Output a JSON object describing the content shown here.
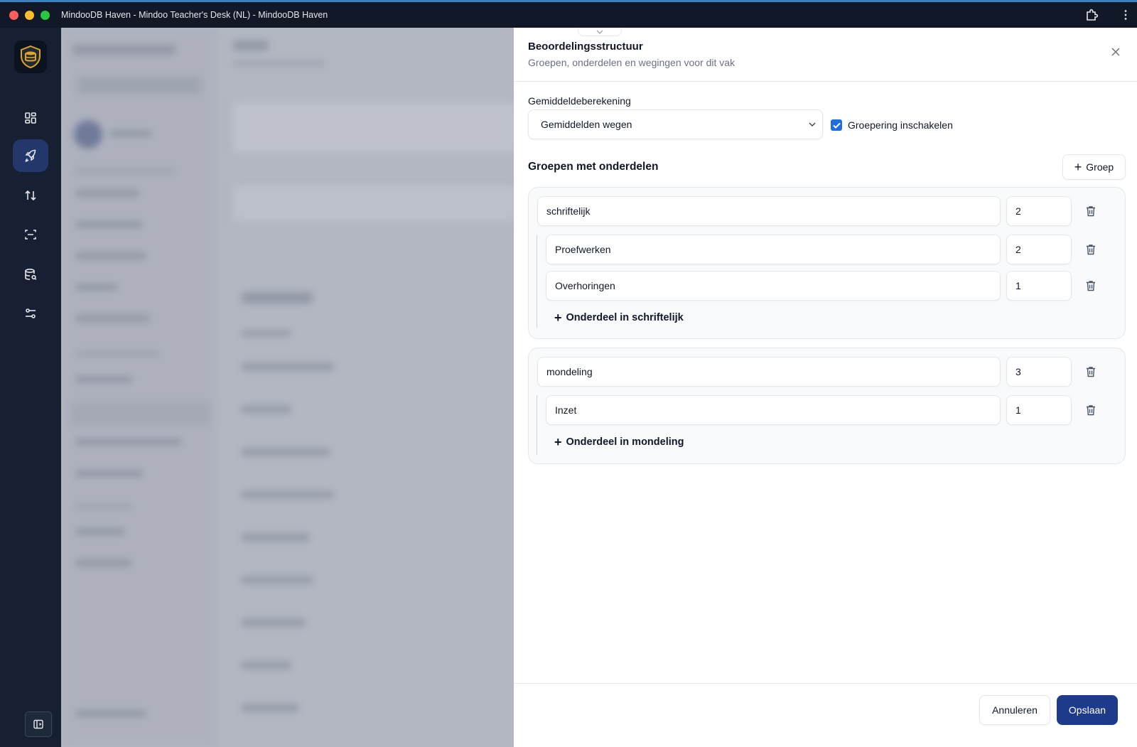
{
  "window": {
    "title": "MindooDB Haven - Mindoo Teacher's Desk (NL) - MindooDB Haven"
  },
  "rail": {
    "items": [
      {
        "icon": "dashboard-grid-icon",
        "active": false
      },
      {
        "icon": "rocket-icon",
        "active": true
      },
      {
        "icon": "sync-arrows-icon",
        "active": false
      },
      {
        "icon": "scan-icon",
        "active": false
      },
      {
        "icon": "database-search-icon",
        "active": false
      },
      {
        "icon": "sliders-icon",
        "active": false
      }
    ],
    "bottom_icon": "sidebar-toggle-icon"
  },
  "panel": {
    "title": "Beoordelingsstructuur",
    "subtitle": "Groepen, onderdelen en wegingen voor dit vak",
    "calc_label": "Gemiddeldeberekening",
    "calc_value": "Gemiddelden wegen",
    "grouping_label": "Groepering inschakelen",
    "grouping_checked": true,
    "groups_title": "Groepen met onderdelen",
    "add_group_label": "Groep",
    "groups": [
      {
        "name": "schriftelijk",
        "weight": "2",
        "parts": [
          {
            "name": "Proefwerken",
            "weight": "2"
          },
          {
            "name": "Overhoringen",
            "weight": "1"
          }
        ],
        "add_part_label": "Onderdeel in schriftelijk"
      },
      {
        "name": "mondeling",
        "weight": "3",
        "parts": [
          {
            "name": "Inzet",
            "weight": "1"
          }
        ],
        "add_part_label": "Onderdeel in mondeling"
      }
    ],
    "cancel_label": "Annuleren",
    "save_label": "Opslaan"
  },
  "colors": {
    "accent": "#1e3a8a",
    "checkbox": "#1d6fe0",
    "rail_bg": "#172033",
    "rail_active": "#23376a"
  }
}
